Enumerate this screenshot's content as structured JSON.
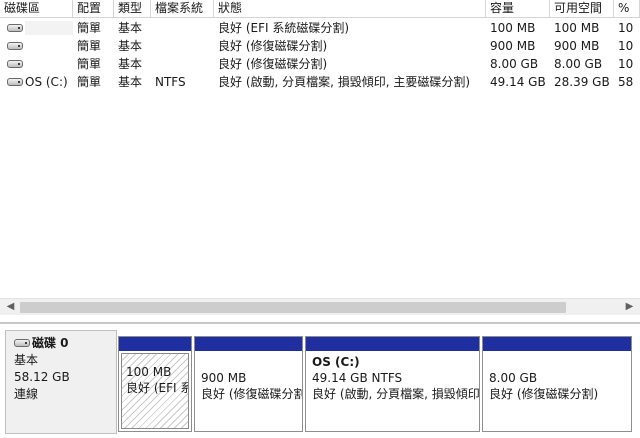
{
  "columns": [
    "磁碟區",
    "配置",
    "類型",
    "檔案系統",
    "狀態",
    "容量",
    "可用空間",
    "%"
  ],
  "volumes": [
    {
      "name": "",
      "layout": "簡單",
      "type": "基本",
      "fs": "",
      "status": "良好 (EFI 系統磁碟分割)",
      "capacity": "100 MB",
      "free": "100 MB",
      "pct": "10"
    },
    {
      "name": "",
      "layout": "簡單",
      "type": "基本",
      "fs": "",
      "status": "良好 (修復磁碟分割)",
      "capacity": "900 MB",
      "free": "900 MB",
      "pct": "10"
    },
    {
      "name": "",
      "layout": "簡單",
      "type": "基本",
      "fs": "",
      "status": "良好 (修復磁碟分割)",
      "capacity": "8.00 GB",
      "free": "8.00 GB",
      "pct": "10"
    },
    {
      "name": "OS (C:)",
      "layout": "簡單",
      "type": "基本",
      "fs": "NTFS",
      "status": "良好 (啟動, 分頁檔案, 損毀傾印, 主要磁碟分割)",
      "capacity": "49.14 GB",
      "free": "28.39 GB",
      "pct": "58"
    }
  ],
  "scrollbar": {
    "left_arrow": "◀",
    "right_arrow": "▶"
  },
  "disk": {
    "name": "磁碟 0",
    "type": "基本",
    "size": "58.12 GB",
    "state": "連線"
  },
  "partitions": [
    {
      "title": "",
      "size": "100 MB",
      "status": "良好 (EFI 系統磁碟分割)"
    },
    {
      "title": "",
      "size": "900 MB",
      "status": "良好 (修復磁碟分割)"
    },
    {
      "title": "OS  (C:)",
      "size": "49.14 GB NTFS",
      "status": "良好 (啟動, 分頁檔案, 損毀傾印, 主要磁碟分割)"
    },
    {
      "title": "",
      "size": "8.00 GB",
      "status": "良好 (修復磁碟分割)"
    }
  ],
  "colors": {
    "partition_bar": "#1f2fa0",
    "disk_info_bg": "#f0f0f0"
  }
}
